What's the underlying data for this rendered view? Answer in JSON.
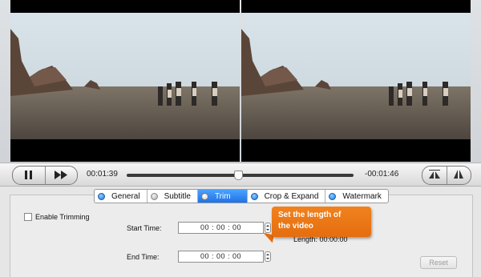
{
  "player": {
    "current_time": "00:01:39",
    "remaining_time": "-00:01:46",
    "progress": 0.49,
    "pause_icon": "pause-icon",
    "forward_icon": "fast-forward-icon",
    "flip_icon": "flip-horizontal-icon",
    "mirror_icon": "flip-vertical-icon"
  },
  "tabs": [
    {
      "label": "General"
    },
    {
      "label": "Subtitle"
    },
    {
      "label": "Trim"
    },
    {
      "label": "Crop & Expand"
    },
    {
      "label": "Watermark"
    }
  ],
  "trim": {
    "enable_label": "Enable Trimming",
    "start_label": "Start Time:",
    "start_value": "00 : 00 : 00",
    "end_label": "End Time:",
    "end_value": "00 : 00 : 00",
    "length_label": "Length: 00:00:00",
    "reset_label": "Reset"
  },
  "callout": {
    "text_line1": "Set the length of",
    "text_line2": "the video"
  },
  "colors": {
    "accent": "#1f72e6",
    "callout": "#ee7a18"
  }
}
